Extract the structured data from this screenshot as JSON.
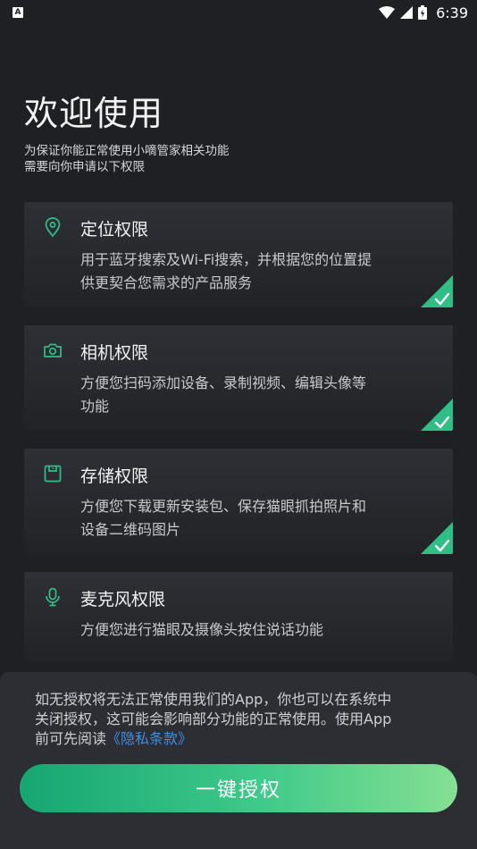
{
  "status_bar": {
    "time": "6:39",
    "app_badge": "A"
  },
  "header": {
    "title": "欢迎使用",
    "subtitle_lines": [
      "为保证你能正常使用小嘀管家相关功能",
      "需要向你申请以下权限"
    ]
  },
  "permissions": [
    {
      "title": "定位权限",
      "icon": "location-pin-icon",
      "desc_lines": [
        "用于蓝牙搜索及Wi-Fi搜索，并根据您的位置提",
        "供更契合您需求的产品服务"
      ],
      "checked": true
    },
    {
      "title": "相机权限",
      "icon": "camera-icon",
      "desc_lines": [
        "方便您扫码添加设备、录制视频、编辑头像等",
        "功能"
      ],
      "checked": true
    },
    {
      "title": "存储权限",
      "icon": "storage-icon",
      "desc_lines": [
        "方便您下载更新安装包、保存猫眼抓拍照片和",
        "设备二维码图片"
      ],
      "checked": true
    },
    {
      "title": "麦克风权限",
      "icon": "microphone-icon",
      "desc_lines": [
        "方便您进行猫眼及摄像头按住说话功能"
      ],
      "checked": false
    }
  ],
  "notice": {
    "line1": "如无授权将无法正常使用我们的App，你也可以在系统中",
    "line2": "关闭授权，这可能会影响部分功能的正常使用。使用App",
    "line3_prefix": "前可先阅读",
    "privacy_link": "《隐私条款》"
  },
  "authorize_button": "一键授权",
  "colors": {
    "accent": "#2fbf86",
    "link": "#3d8fe8",
    "background": "#1f2024"
  }
}
